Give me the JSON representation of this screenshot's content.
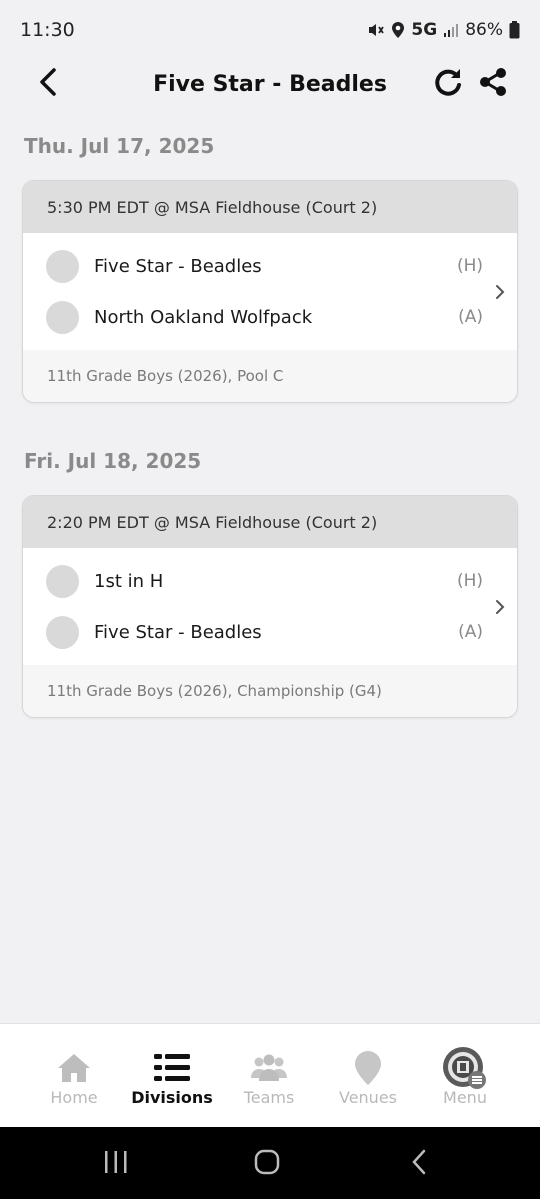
{
  "status_bar": {
    "time": "11:30",
    "network": "5G",
    "battery": "86%"
  },
  "header": {
    "title": "Five Star - Beadles",
    "back_icon": "chevron-left-icon",
    "refresh_icon": "refresh-icon",
    "share_icon": "share-icon"
  },
  "days": [
    {
      "date": "Thu. Jul 17, 2025",
      "game": {
        "time_location": "5:30 PM EDT @ MSA Fieldhouse (Court 2)",
        "teams": [
          {
            "name": "Five Star - Beadles",
            "side": "(H)"
          },
          {
            "name": "North Oakland Wolfpack",
            "side": "(A)"
          }
        ],
        "division": "11th Grade Boys (2026), Pool C"
      }
    },
    {
      "date": "Fri. Jul 18, 2025",
      "game": {
        "time_location": "2:20 PM EDT @ MSA Fieldhouse (Court 2)",
        "teams": [
          {
            "name": "1st in H",
            "side": "(H)"
          },
          {
            "name": "Five Star - Beadles",
            "side": "(A)"
          }
        ],
        "division": "11th Grade Boys (2026), Championship (G4)"
      }
    }
  ],
  "bottom_nav": [
    {
      "label": "Home",
      "icon": "home-icon",
      "active": false
    },
    {
      "label": "Divisions",
      "icon": "divisions-icon",
      "active": true
    },
    {
      "label": "Teams",
      "icon": "teams-icon",
      "active": false
    },
    {
      "label": "Venues",
      "icon": "map-pin-icon",
      "active": false
    },
    {
      "label": "Menu",
      "icon": "menu-logo-icon",
      "active": false
    }
  ],
  "colors": {
    "background": "#f1f1f3",
    "card_header": "#dedede",
    "muted_text": "#8a8a8a",
    "active_nav": "#111111",
    "inactive_nav": "#b9b9b9"
  }
}
